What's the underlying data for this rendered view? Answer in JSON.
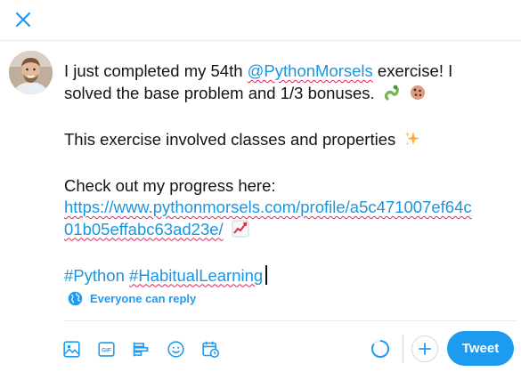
{
  "header": {
    "close_icon": "close-icon"
  },
  "author": {
    "avatar_icon": "user-avatar"
  },
  "tweet": {
    "line1_pre": "I just completed my 54th ",
    "mention": "@PythonMorsels",
    "line1_post": " exercise! I",
    "line2": "solved the base problem and 1/3 bonuses.",
    "line2_emojis": [
      "snake-emoji",
      "cookie-emoji"
    ],
    "line4": "This exercise involved classes and properties",
    "line4_emoji": "sparkles-emoji",
    "line6": "Check out my progress here:",
    "url_part1": "https://www.pythonmorsels.com/profile/a5c471007ef64c",
    "url_part2": "01b05effabc63ad23e/",
    "url_emoji": "chart-increasing-emoji",
    "hashtag1": "#Python",
    "hashtag2": "#HabitualLearning"
  },
  "reply_setting": {
    "label": "Everyone can reply",
    "icon": "globe-icon"
  },
  "toolbar": {
    "icons": [
      "image-icon",
      "gif-icon",
      "poll-icon",
      "emoji-icon",
      "schedule-icon"
    ],
    "gif_label": "GIF",
    "character_progress": 0.85,
    "tweet_label": "Tweet"
  },
  "colors": {
    "accent": "#1d9bf0",
    "link": "#1b95e0",
    "spellcheck": "#e0245e",
    "border": "#e6ecf0"
  }
}
